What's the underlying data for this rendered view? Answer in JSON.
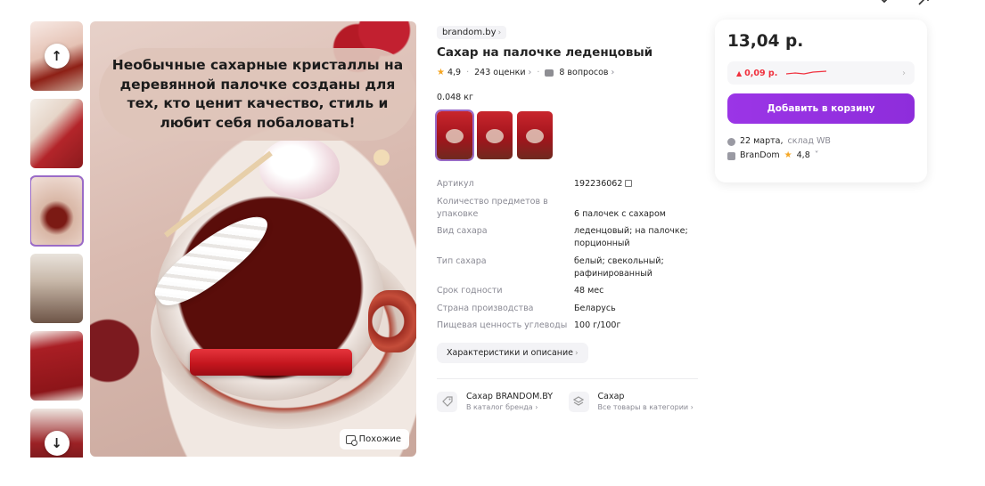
{
  "top_icons": [
    "chevron-down-icon",
    "share-icon"
  ],
  "gallery": {
    "thumbnails": [
      {
        "name": "product-photo-1"
      },
      {
        "name": "product-photo-2"
      },
      {
        "name": "product-photo-3",
        "active": true
      },
      {
        "name": "product-photo-4"
      },
      {
        "name": "product-photo-5"
      },
      {
        "name": "product-photo-6"
      }
    ],
    "main_image_caption": "Необычные сахарные кристаллы на деревянной палочке созданы для тех, кто ценит качество, стиль и любит себя побаловать!",
    "similar_label": "Похожие"
  },
  "product": {
    "brand": "brandom.by",
    "title": "Сахар на палочке леденцовый",
    "rating": "4,9",
    "reviews": "243 оценки",
    "questions": "8 вопросов",
    "weight": "0.048 кг"
  },
  "specs": [
    {
      "key": "Артикул",
      "value": "192236062"
    },
    {
      "key": "Количество предметов в упаковке",
      "value": "6 палочек с сахаром"
    },
    {
      "key": "Вид сахара",
      "value": "леденцовый; на палочке; порционный"
    },
    {
      "key": "Тип сахара",
      "value": "белый; свекольный; рафинированный"
    },
    {
      "key": "Срок годности",
      "value": "48 мес"
    },
    {
      "key": "Страна производства",
      "value": "Беларусь"
    },
    {
      "key": "Пищевая ценность углеводы",
      "value": "100 г/100г"
    }
  ],
  "description_button": "Характеристики и описание",
  "links": [
    {
      "title": "Сахар BRANDOM.BY",
      "subtitle": "В каталог бренда"
    },
    {
      "title": "Сахар",
      "subtitle": "Все товары в категории"
    }
  ],
  "price_card": {
    "price": "13,04 р.",
    "price_change": "0,09 р.",
    "add_to_cart": "Добавить в корзину",
    "delivery_date": "22 марта,",
    "warehouse": "склад WB",
    "seller": "BranDom",
    "seller_rating": "4,8"
  },
  "colors": {
    "accent": "#9b35e6",
    "price_up": "#f0313e",
    "star": "#f5a623"
  }
}
